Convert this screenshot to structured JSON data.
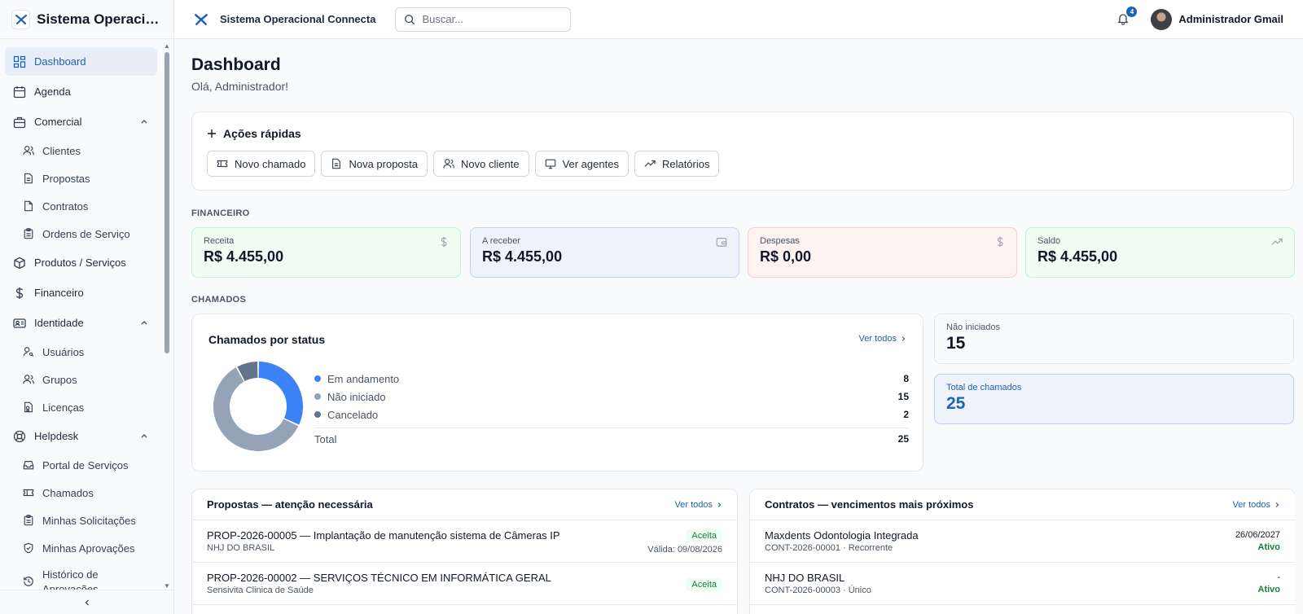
{
  "sidebar": {
    "brand": "Sistema Operacional Connecta",
    "items": [
      {
        "label": "Dashboard"
      },
      {
        "label": "Agenda"
      },
      {
        "label": "Comercial"
      },
      {
        "label": "Clientes"
      },
      {
        "label": "Propostas"
      },
      {
        "label": "Contratos"
      },
      {
        "label": "Ordens de Serviço"
      },
      {
        "label": "Produtos / Serviços"
      },
      {
        "label": "Financeiro"
      },
      {
        "label": "Identidade"
      },
      {
        "label": "Usuários"
      },
      {
        "label": "Grupos"
      },
      {
        "label": "Licenças"
      },
      {
        "label": "Helpdesk"
      },
      {
        "label": "Portal de Serviços"
      },
      {
        "label": "Chamados"
      },
      {
        "label": "Minhas Solicitações"
      },
      {
        "label": "Minhas Aprovações"
      },
      {
        "label": "Histórico de Aprovações"
      }
    ]
  },
  "topbar": {
    "title": "Sistema Operacional Connecta",
    "search_placeholder": "Buscar...",
    "notifications": "4",
    "user": "Administrador Gmail"
  },
  "page": {
    "title": "Dashboard",
    "subtitle": "Olá, Administrador!"
  },
  "quick_actions": {
    "title": "Ações rápidas",
    "buttons": [
      {
        "label": "Novo chamado",
        "icon": "ticket-icon"
      },
      {
        "label": "Nova proposta",
        "icon": "document-icon"
      },
      {
        "label": "Novo cliente",
        "icon": "users-icon"
      },
      {
        "label": "Ver agentes",
        "icon": "monitor-icon"
      },
      {
        "label": "Relatórios",
        "icon": "trending-up-icon"
      }
    ]
  },
  "financeiro": {
    "section": "FINANCEIRO",
    "cards": [
      {
        "label": "Receita",
        "value": "R$ 4.455,00"
      },
      {
        "label": "A receber",
        "value": "R$ 4.455,00"
      },
      {
        "label": "Despesas",
        "value": "R$ 0,00"
      },
      {
        "label": "Saldo",
        "value": "R$ 4.455,00"
      }
    ]
  },
  "chamados": {
    "section": "CHAMADOS",
    "chart_title": "Chamados por status",
    "ver_todos": "Ver todos",
    "total_label": "Total",
    "total_value": "25",
    "stats": [
      {
        "label": "Não iniciados",
        "value": "15"
      },
      {
        "label": "Total de chamados",
        "value": "25"
      }
    ]
  },
  "chart_data": {
    "type": "pie",
    "categories": [
      "Em andamento",
      "Não iniciado",
      "Cancelado"
    ],
    "values": [
      8,
      15,
      2
    ],
    "colors": [
      "#3b82f6",
      "#94a3b8",
      "#64748b"
    ]
  },
  "propostas": {
    "title": "Propostas — atenção necessária",
    "ver_todos": "Ver todos",
    "rows": [
      {
        "title": "PROP-2026-00005 — Implantação de manutenção sistema de Câmeras IP",
        "client": "NHJ DO BRASIL",
        "status": "Aceita",
        "valid": "Válida: 09/08/2026"
      },
      {
        "title": "PROP-2026-00002 — SERVIÇOS TÉCNICO EM INFORMÁTICA GERAL",
        "client": "Sensivita Clinica de Saúde",
        "status": "Aceita",
        "valid": ""
      }
    ]
  },
  "contratos": {
    "title": "Contratos — vencimentos mais próximos",
    "ver_todos": "Ver todos",
    "rows": [
      {
        "title": "Maxdents Odontologia Integrada",
        "sub": "CONT-2026-00001 · Recorrente",
        "date": "26/06/2027",
        "status": "Ativo"
      },
      {
        "title": "NHJ DO BRASIL",
        "sub": "CONT-2026-00003 · Único",
        "date": "-",
        "status": "Ativo"
      }
    ]
  },
  "colors": {
    "accent": "#1d64b0"
  }
}
